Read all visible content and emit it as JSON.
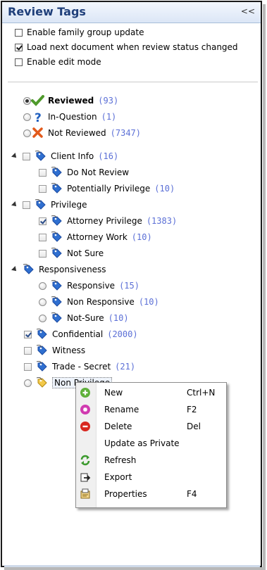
{
  "panel": {
    "title": "Review Tags",
    "collapse_glyph": "<<"
  },
  "options": [
    {
      "label": "Enable family group update",
      "checked": false
    },
    {
      "label": "Load next document when review status changed",
      "checked": true
    },
    {
      "label": "Enable edit mode",
      "checked": false
    }
  ],
  "status": [
    {
      "label": "Reviewed",
      "count": "(93)",
      "selected": true,
      "icon": "checkmark-icon",
      "color": "#4f9a2c"
    },
    {
      "label": "In-Question",
      "count": "(1)",
      "selected": false,
      "icon": "question-icon",
      "color": "#1f5fbf"
    },
    {
      "label": "Not Reviewed",
      "count": "(7347)",
      "selected": false,
      "icon": "x-icon",
      "color": "#e25a1c"
    }
  ],
  "tree": {
    "client_info": {
      "label": "Client Info",
      "count": "(16)",
      "children": [
        {
          "label": "Do Not Review",
          "count": ""
        },
        {
          "label": "Potentially Privilege",
          "count": "(10)"
        }
      ]
    },
    "privilege": {
      "label": "Privilege",
      "children": [
        {
          "label": "Attorney Privilege",
          "count": "(1383)",
          "checked": true
        },
        {
          "label": "Attorney Work",
          "count": "(10)"
        },
        {
          "label": "Not Sure",
          "count": ""
        }
      ]
    },
    "responsiveness": {
      "label": "Responsiveness",
      "children": [
        {
          "label": "Responsive",
          "count": "(15)"
        },
        {
          "label": "Non Responsive",
          "count": "(10)"
        },
        {
          "label": "Not-Sure",
          "count": "(10)"
        }
      ]
    },
    "confidential": {
      "label": "Confidential",
      "count": "(2000)",
      "checked": true
    },
    "witness": {
      "label": "Witness"
    },
    "trade_secret": {
      "label": "Trade - Secret",
      "count": "(21)"
    },
    "non_privilege": {
      "label": "Non Privilege"
    }
  },
  "context_menu": [
    {
      "label": "New",
      "shortcut": "Ctrl+N",
      "icon": "plus-circle-icon"
    },
    {
      "label": "Rename",
      "shortcut": "F2",
      "icon": "rename-icon"
    },
    {
      "label": "Delete",
      "shortcut": "Del",
      "icon": "minus-circle-icon"
    },
    {
      "label": "Update as Private",
      "shortcut": "",
      "icon": ""
    },
    {
      "label": "Refresh",
      "shortcut": "",
      "icon": "refresh-icon"
    },
    {
      "label": "Export",
      "shortcut": "",
      "icon": "export-icon"
    },
    {
      "label": "Properties",
      "shortcut": "F4",
      "icon": "properties-icon"
    }
  ],
  "colors": {
    "title": "#1f3f7a",
    "count": "#5b6fd6",
    "tag_blue": "#2f6fd0",
    "tag_yellow": "#f3c94a"
  }
}
